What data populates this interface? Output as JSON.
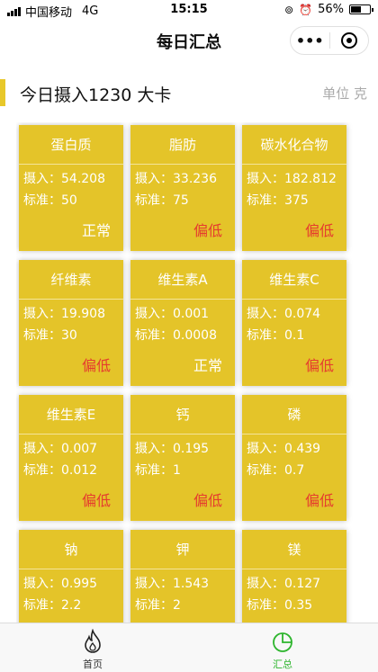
{
  "status_bar": {
    "carrier": "中国移动",
    "network": "4G",
    "time": "15:15",
    "battery": "56%",
    "battery_level": 0.56
  },
  "nav": {
    "title": "每日汇总"
  },
  "summary": {
    "title": "今日摄入1230 大卡",
    "unit": "单位 克"
  },
  "labels": {
    "intake": "摄入：",
    "standard": "标准："
  },
  "nutrients": [
    {
      "name": "蛋白质",
      "intake": "54.208",
      "standard": "50",
      "status": "正常"
    },
    {
      "name": "脂肪",
      "intake": "33.236",
      "standard": "75",
      "status": "偏低"
    },
    {
      "name": "碳水化合物",
      "intake": "182.812",
      "standard": "375",
      "status": "偏低"
    },
    {
      "name": "纤维素",
      "intake": "19.908",
      "standard": "30",
      "status": "偏低"
    },
    {
      "name": "维生素A",
      "intake": "0.001",
      "standard": "0.0008",
      "status": "正常"
    },
    {
      "name": "维生素C",
      "intake": "0.074",
      "standard": "0.1",
      "status": "偏低"
    },
    {
      "name": "维生素E",
      "intake": "0.007",
      "standard": "0.012",
      "status": "偏低"
    },
    {
      "name": "钙",
      "intake": "0.195",
      "standard": "1",
      "status": "偏低"
    },
    {
      "name": "磷",
      "intake": "0.439",
      "standard": "0.7",
      "status": "偏低"
    },
    {
      "name": "钠",
      "intake": "0.995",
      "standard": "2.2",
      "status": ""
    },
    {
      "name": "钾",
      "intake": "1.543",
      "standard": "2",
      "status": ""
    },
    {
      "name": "镁",
      "intake": "0.127",
      "standard": "0.35",
      "status": ""
    }
  ],
  "tabs": [
    {
      "label": "首页",
      "icon": "flame-icon",
      "active": false
    },
    {
      "label": "汇总",
      "icon": "pie-chart-icon",
      "active": true
    }
  ],
  "colors": {
    "accent": "#e8c82a",
    "card": "#e4c429",
    "status_low": "#e53c2e",
    "status_normal": "#ffffff",
    "tab_active": "#2db52d"
  }
}
